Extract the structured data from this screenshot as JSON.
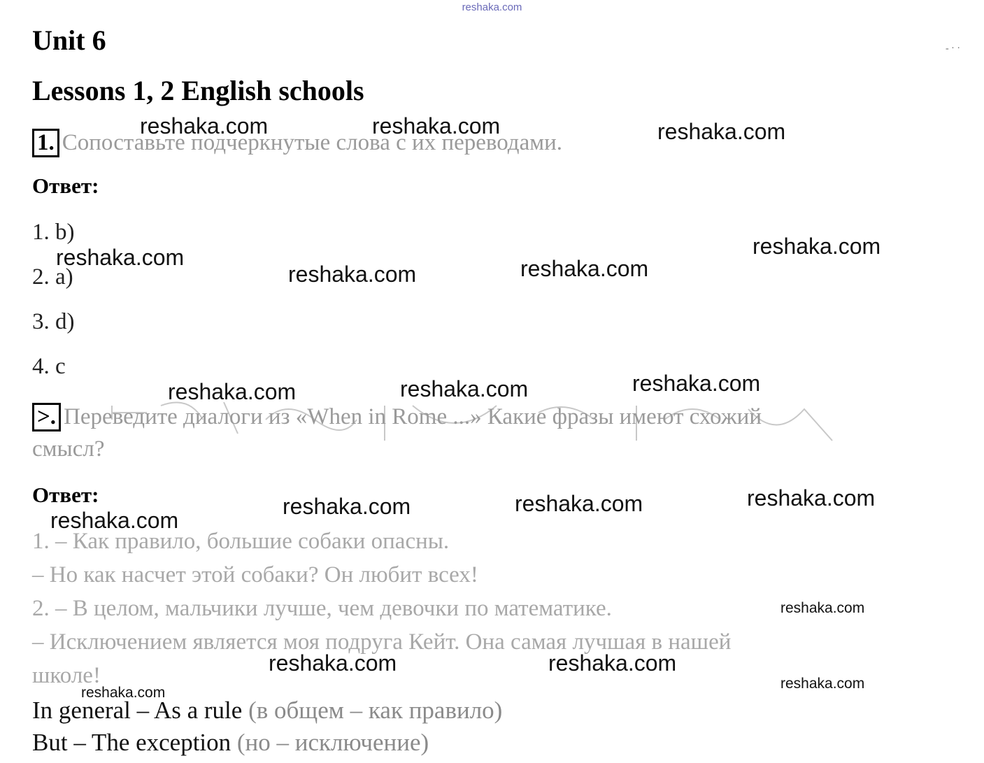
{
  "site_watermark": "reshaka.com",
  "unit_title": "Unit 6",
  "lesson_title": "Lessons 1, 2 English schools",
  "task1": {
    "number": "1.",
    "text": "Сопоставьте подчеркнутые слова с их переводами.",
    "answer_label": "Ответ:",
    "answers": [
      "1. b)",
      "2. a)",
      "3. d)",
      "4. c"
    ]
  },
  "task2": {
    "number": ">.",
    "text": "Переведите диалоги из «When in Rome ...» Какие фразы имеют схожий",
    "text_cont": "смысл?",
    "answer_label": "Ответ:",
    "dialog": [
      "1. – Как правило, большие собаки опасны.",
      "– Но как насчет этой собаки? Он любит всех!",
      "2. – В целом, мальчики лучше, чем девочки по математике.",
      "– Исключением является моя подруга Кейт. Она самая лучшая в нашей",
      "школе!"
    ],
    "phrases": [
      {
        "en": "In general – As a rule",
        "ru": "(в общем – как правило)"
      },
      {
        "en": "But – The exception",
        "ru": "(но – исключение)"
      }
    ]
  },
  "watermark_text": "reshaka.com"
}
